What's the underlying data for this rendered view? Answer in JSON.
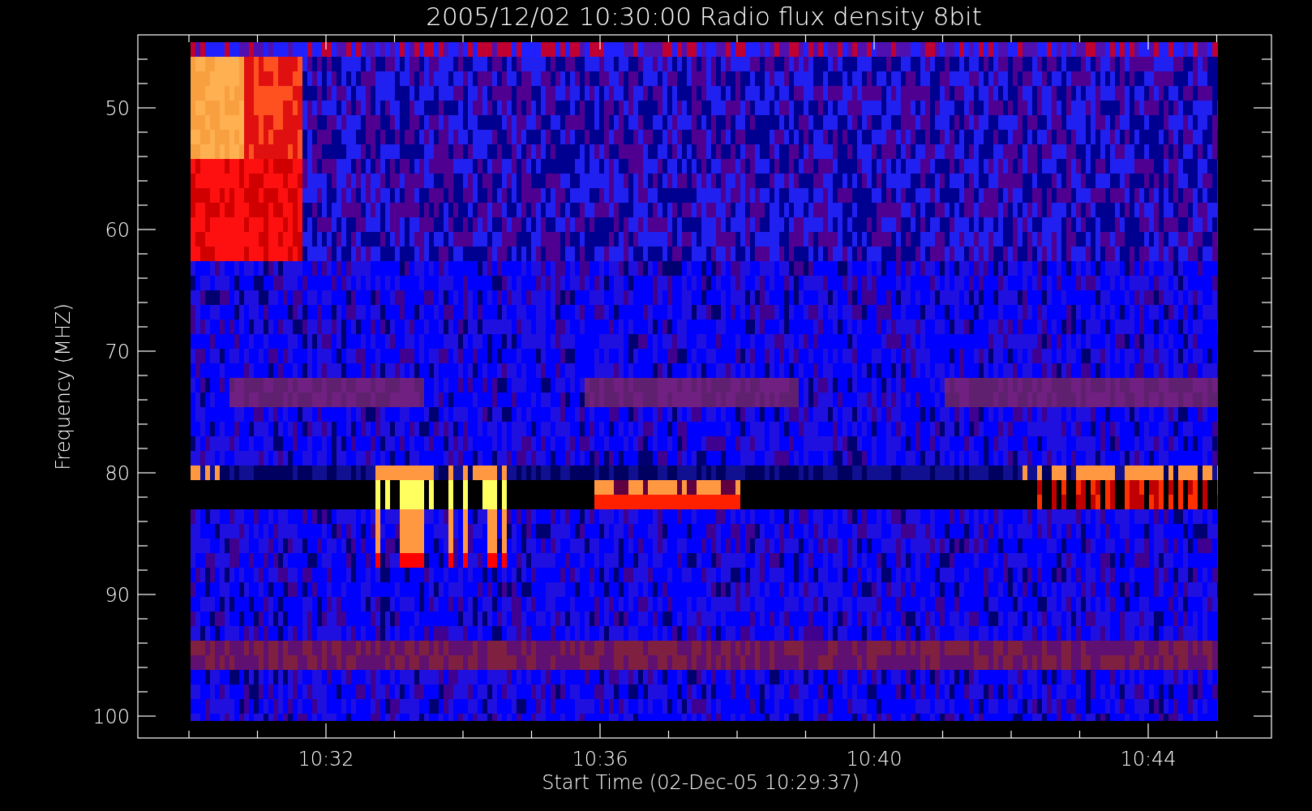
{
  "title": "2005/12/02 10:30:00 Radio flux density 8bit",
  "x_axis": {
    "label": "Start Time (02-Dec-05 10:29:37)",
    "ticks": [
      "10:32",
      "10:36",
      "10:40",
      "10:44"
    ]
  },
  "y_axis": {
    "label": "Frequency (MHZ)",
    "ticks": [
      "50",
      "60",
      "70",
      "80",
      "90",
      "100"
    ]
  }
}
